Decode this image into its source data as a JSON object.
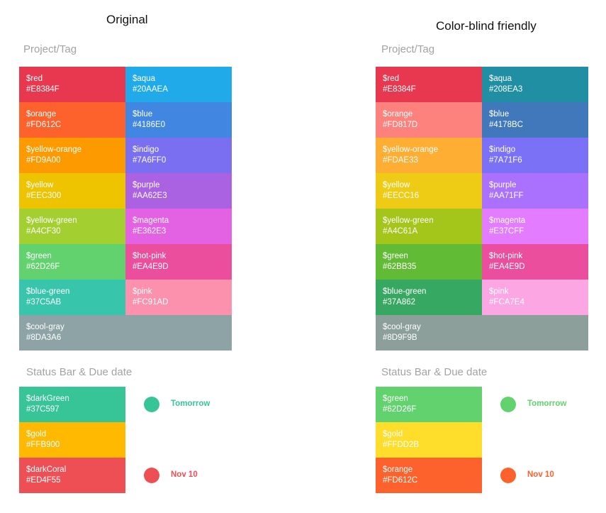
{
  "original": {
    "title": "Original",
    "project_heading": "Project/Tag",
    "project_swatches": [
      {
        "name": "$red",
        "hex": "#E8384F",
        "color": "#E8384F",
        "text_color": "#ffffff"
      },
      {
        "name": "$aqua",
        "hex": "#20AAEA",
        "color": "#20AAEA",
        "text_color": "#ffffff"
      },
      {
        "name": "$orange",
        "hex": "#FD612C",
        "color": "#FD612C",
        "text_color": "#ffffff"
      },
      {
        "name": "$blue",
        "hex": "#4186E0",
        "color": "#4186E0",
        "text_color": "#ffffff"
      },
      {
        "name": "$yellow-orange",
        "hex": "#FD9A00",
        "color": "#FD9A00",
        "text_color": "#ffffff"
      },
      {
        "name": "$indigo",
        "hex": "#7A6FF0",
        "color": "#7A6FF0",
        "text_color": "#ffffff"
      },
      {
        "name": "$yellow",
        "hex": "#EEC300",
        "color": "#EEC300",
        "text_color": "#ffffff"
      },
      {
        "name": "$purple",
        "hex": "#AA62E3",
        "color": "#AA62E3",
        "text_color": "#ffffff"
      },
      {
        "name": "$yellow-green",
        "hex": "#A4CF30",
        "color": "#A4CF30",
        "text_color": "#ffffff"
      },
      {
        "name": "$magenta",
        "hex": "#E362E3",
        "color": "#E362E3",
        "text_color": "#ffffff"
      },
      {
        "name": "$green",
        "hex": "#62D26F",
        "color": "#62D26F",
        "text_color": "#ffffff"
      },
      {
        "name": "$hot-pink",
        "hex": "#EA4E9D",
        "color": "#EA4E9D",
        "text_color": "#ffffff"
      },
      {
        "name": "$blue-green",
        "hex": "#37C5AB",
        "color": "#37C5AB",
        "text_color": "#ffffff"
      },
      {
        "name": "$pink",
        "hex": "#FC91AD",
        "color": "#FC91AD",
        "text_color": "#ffffff"
      },
      {
        "name": "$cool-gray",
        "hex": "#8DA3A6",
        "color": "#8DA3A6",
        "text_color": "#ffffff"
      }
    ],
    "status_heading": "Status Bar & Due date",
    "status_swatches": [
      {
        "name": "$darkGreen",
        "hex": "#37C597",
        "color": "#37C597",
        "text_color": "#ffffff"
      },
      {
        "name": "$gold",
        "hex": "#FFB900",
        "color": "#FFB900",
        "text_color": "#ffffff"
      },
      {
        "name": "$darkCoral",
        "hex": "#ED4F55",
        "color": "#ED4F55",
        "text_color": "#ffffff"
      }
    ],
    "due_tomorrow": {
      "label": "Tomorrow",
      "color": "#37C597"
    },
    "due_date": {
      "label": "Nov 10",
      "color": "#ED4F55"
    }
  },
  "colorblind": {
    "title": "Color-blind friendly",
    "project_heading": "Project/Tag",
    "project_swatches": [
      {
        "name": "$red",
        "hex": "#E8384F",
        "color": "#E8384F",
        "text_color": "#ffffff"
      },
      {
        "name": "$aqua",
        "hex": "#208EA3",
        "color": "#208EA3",
        "text_color": "#ffffff"
      },
      {
        "name": "$orange",
        "hex": "#FD817D",
        "color": "#FD817D",
        "text_color": "#ffffff"
      },
      {
        "name": "$blue",
        "hex": "#4178BC",
        "color": "#4178BC",
        "text_color": "#ffffff"
      },
      {
        "name": "$yellow-orange",
        "hex": "#FDAE33",
        "color": "#FDAE33",
        "text_color": "#ffffff"
      },
      {
        "name": "$indigo",
        "hex": "#7A71F6",
        "color": "#7A71F6",
        "text_color": "#ffffff"
      },
      {
        "name": "$yellow",
        "hex": "#EECC16",
        "color": "#EECC16",
        "text_color": "#ffffff"
      },
      {
        "name": "$purple",
        "hex": "#AA71FF",
        "color": "#AA71FF",
        "text_color": "#ffffff"
      },
      {
        "name": "$yellow-green",
        "hex": "#A4C61A",
        "color": "#A4C61A",
        "text_color": "#ffffff"
      },
      {
        "name": "$magenta",
        "hex": "#E37CFF",
        "color": "#E37CFF",
        "text_color": "#ffffff"
      },
      {
        "name": "$green",
        "hex": "#62BB35",
        "color": "#62BB35",
        "text_color": "#ffffff"
      },
      {
        "name": "$hot-pink",
        "hex": "#EA4E9D",
        "color": "#EA4E9D",
        "text_color": "#ffffff"
      },
      {
        "name": "$blue-green",
        "hex": "#37A862",
        "color": "#37A862",
        "text_color": "#ffffff"
      },
      {
        "name": "$pink",
        "hex": "#FCA7E4",
        "color": "#FCA7E4",
        "text_color": "#ffffff"
      },
      {
        "name": "$cool-gray",
        "hex": "#8D9F9B",
        "color": "#8D9F9B",
        "text_color": "#ffffff"
      }
    ],
    "status_heading": "Status Bar & Due date",
    "status_swatches": [
      {
        "name": "$green",
        "hex": "#62D26F",
        "color": "#62D26F",
        "text_color": "#ffffff"
      },
      {
        "name": "$gold",
        "hex": "#FFDD2B",
        "color": "#FFDD2B",
        "text_color": "#ffffff"
      },
      {
        "name": "$orange",
        "hex": "#FD612C",
        "color": "#FD612C",
        "text_color": "#ffffff"
      }
    ],
    "due_tomorrow": {
      "label": "Tomorrow",
      "color": "#62D26F"
    },
    "due_date": {
      "label": "Nov 10",
      "color": "#FD612C"
    }
  }
}
